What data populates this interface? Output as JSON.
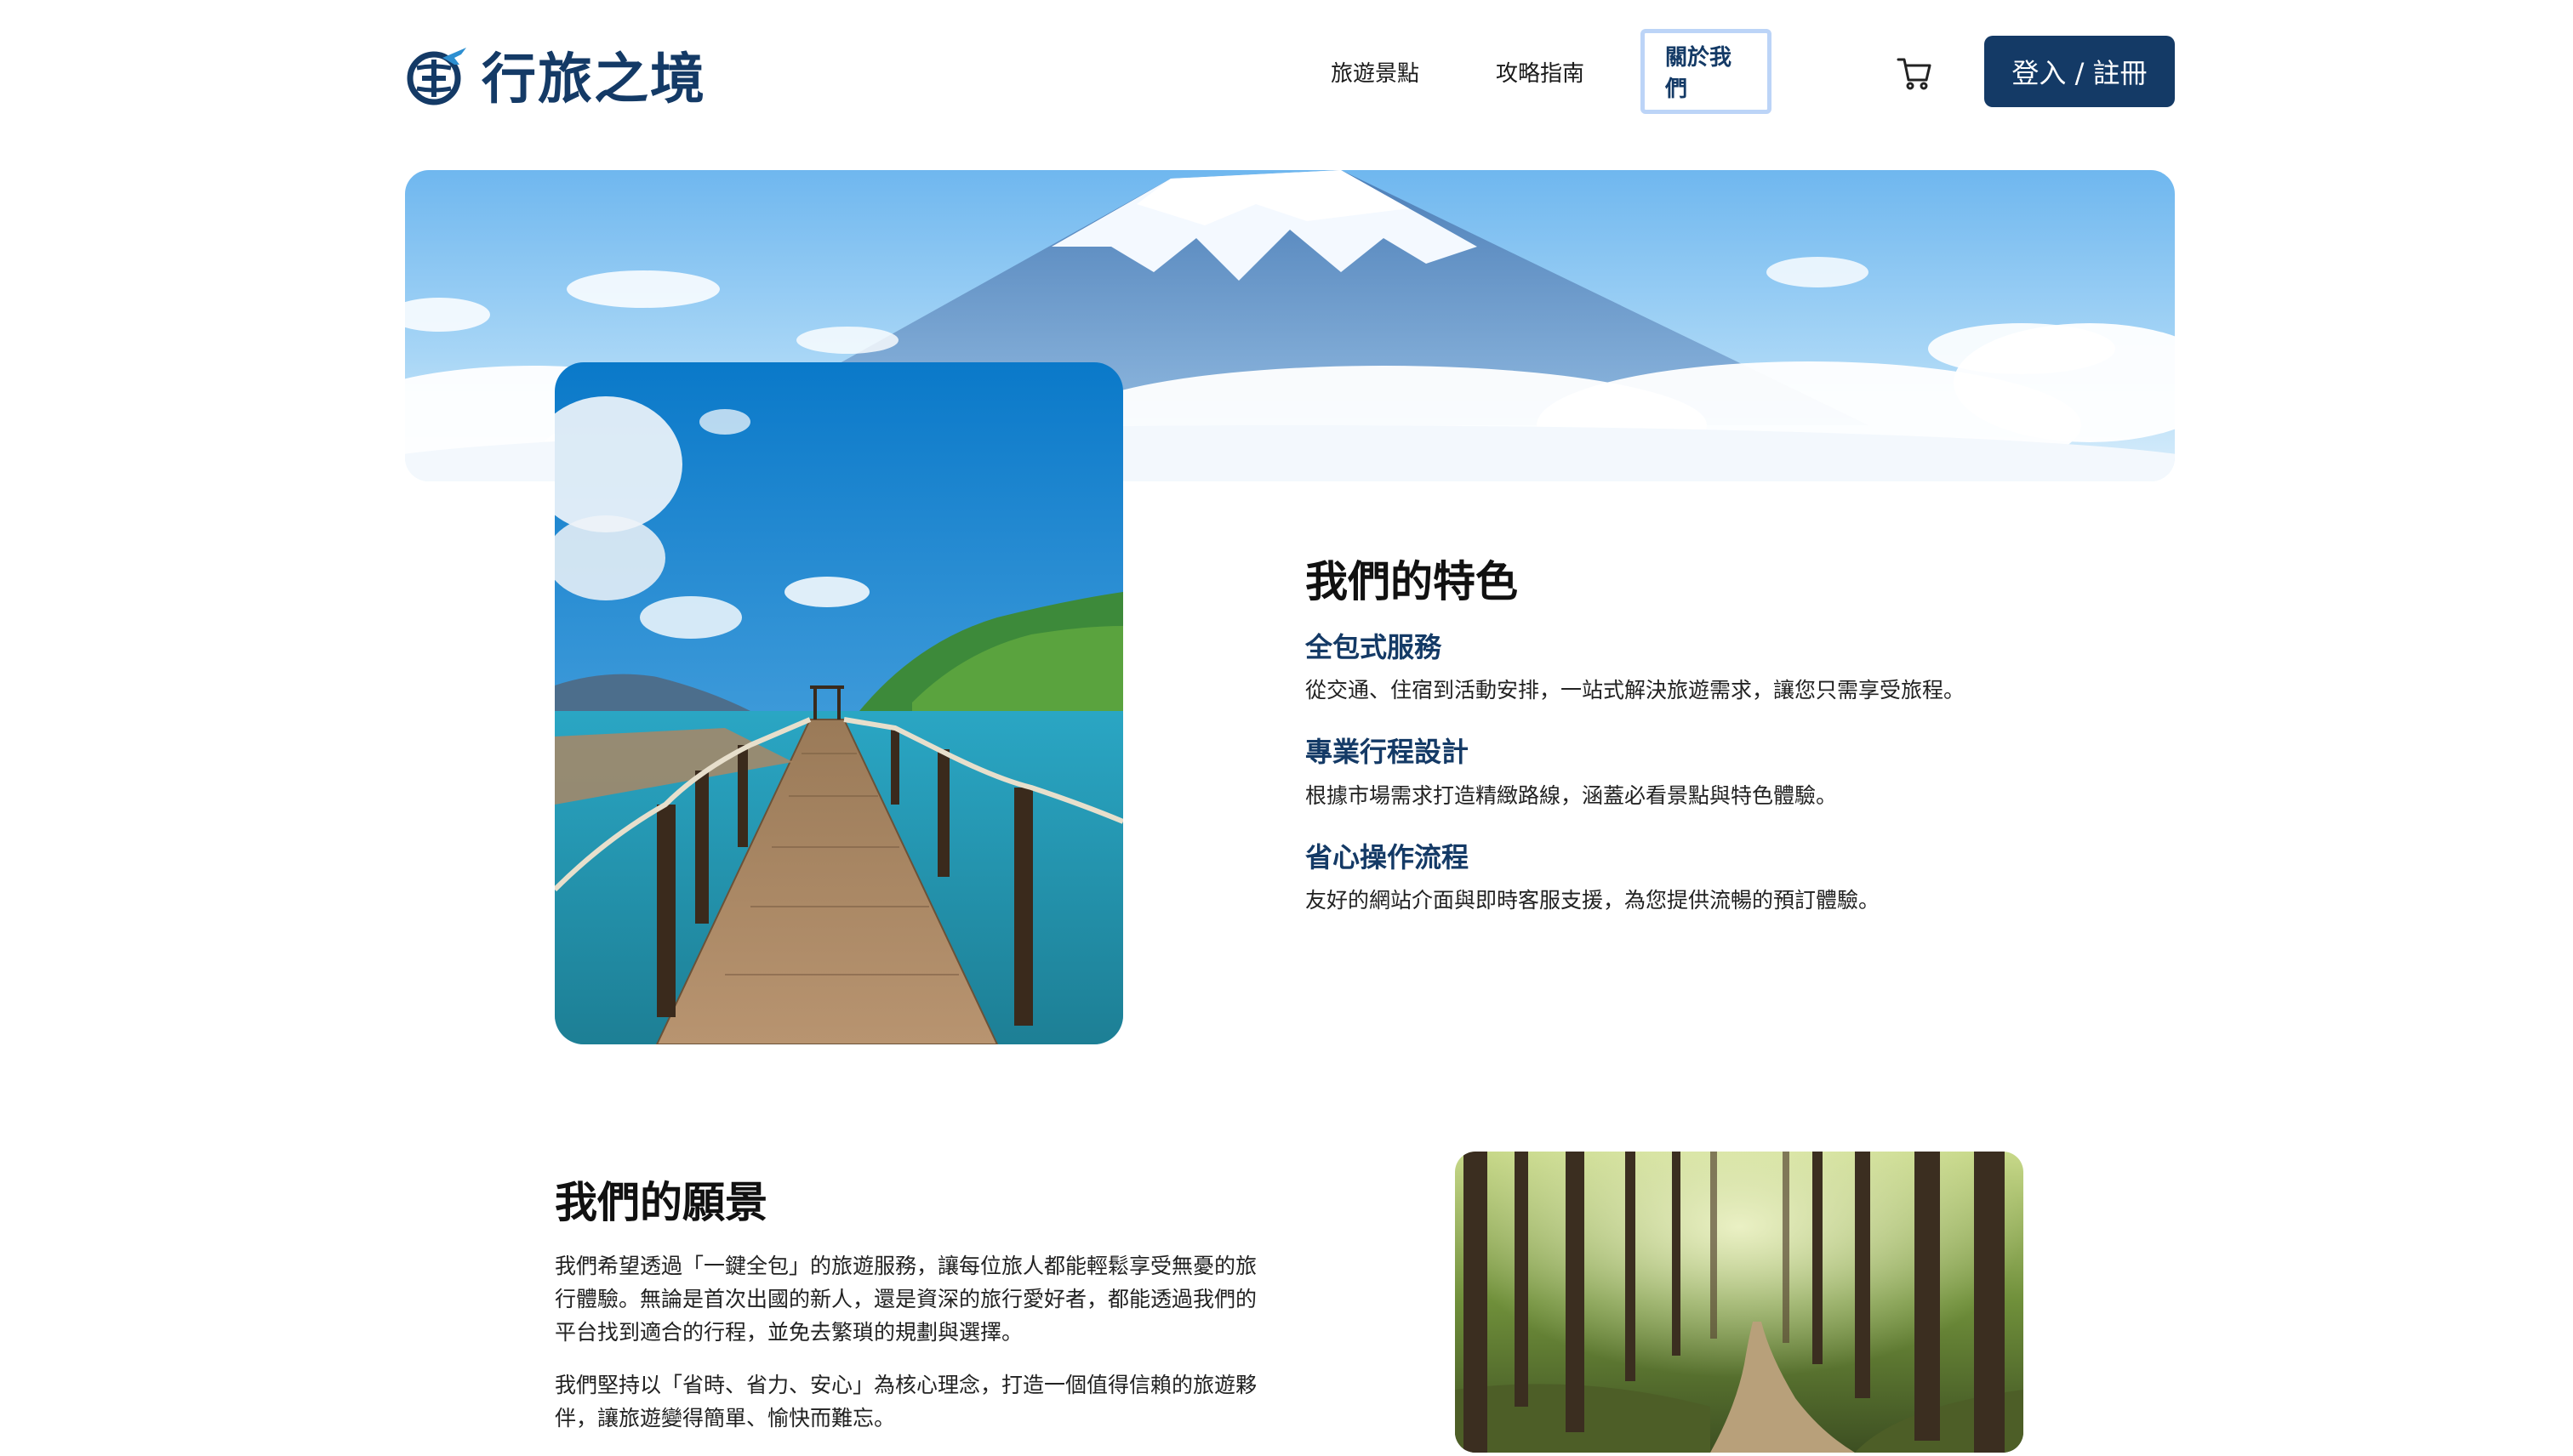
{
  "brand": {
    "name": "行旅之境",
    "logo_icon": "globe-plane-icon",
    "color": "#143a66"
  },
  "nav": {
    "items": [
      {
        "label": "旅遊景點"
      },
      {
        "label": "攻略指南"
      },
      {
        "label": "關於我們",
        "active": true
      }
    ],
    "cart_icon": "cart-icon",
    "login_label": "登入 / 註冊"
  },
  "hero": {
    "image": "mount-fuji-banner"
  },
  "features": {
    "image": "wooden-pier-photo",
    "title": "我們的特色",
    "items": [
      {
        "title": "全包式服務",
        "desc": "從交通、住宿到活動安排，一站式解決旅遊需求，讓您只需享受旅程。"
      },
      {
        "title": "專業行程設計",
        "desc": "根據市場需求打造精緻路線，涵蓋必看景點與特色體驗。"
      },
      {
        "title": "省心操作流程",
        "desc": "友好的網站介面與即時客服支援，為您提供流暢的預訂體驗。"
      }
    ]
  },
  "vision": {
    "title": "我們的願景",
    "paragraphs": [
      "我們希望透過「一鍵全包」的旅遊服務，讓每位旅人都能輕鬆享受無憂的旅行體驗。無論是首次出國的新人，還是資深的旅行愛好者，都能透過我們的平台找到適合的行程，並免去繁瑣的規劃與選擇。",
      "我們堅持以「省時、省力、安心」為核心理念，打造一個值得信賴的旅遊夥伴，讓旅遊變得簡單、愉快而難忘。"
    ],
    "image": "forest-path-photo"
  },
  "colors": {
    "primary": "#143a66",
    "active_outline": "#bcd4f7",
    "background": "#ffffff"
  }
}
